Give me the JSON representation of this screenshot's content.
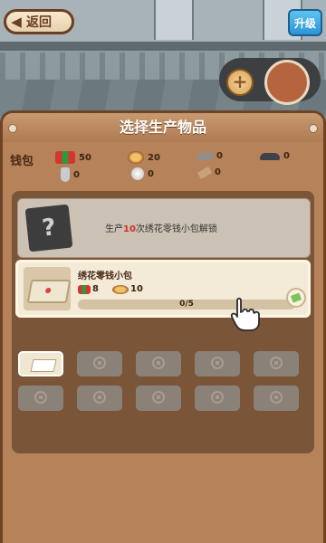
{
  "header": {
    "back_label": "返回",
    "upgrade_label": "升级"
  },
  "panel": {
    "title": "选择生产物品",
    "wallet_label": "钱包",
    "resources": [
      {
        "icon": "thread-icon",
        "value": "50"
      },
      {
        "icon": "yarn-icon",
        "value": "20"
      },
      {
        "icon": "board-icon",
        "value": "0"
      },
      {
        "icon": "iron-icon",
        "value": "0"
      },
      {
        "icon": "sock-icon",
        "value": "0"
      },
      {
        "icon": "cotton-icon",
        "value": "0"
      },
      {
        "icon": "wood-icon",
        "value": "0"
      }
    ]
  },
  "locked_item": {
    "prefix": "生产",
    "count": "10",
    "suffix": "次绣花零钱小包解锁"
  },
  "item": {
    "name": "绣花零钱小包",
    "cost_thread": "8",
    "cost_yarn": "10",
    "progress_text": "0/5",
    "progress_fraction": 0
  },
  "slots": {
    "rows": 2,
    "cols": 5,
    "active_index": 0
  },
  "colors": {
    "panel": "#b5825a",
    "panel_border": "#6e4426",
    "upgrade": "#2d93d6",
    "accent_red": "#d0302a"
  }
}
